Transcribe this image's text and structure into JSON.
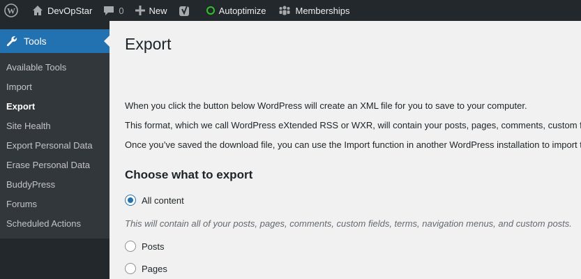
{
  "adminbar": {
    "site_name": "DevOpStar",
    "comments_count": "0",
    "new_label": "New",
    "autoptimize_label": "Autoptimize",
    "memberships_label": "Memberships",
    "autoptimize_status_color": "#2fc427"
  },
  "sidebar": {
    "menu_label": "Tools",
    "items": [
      {
        "label": "Available Tools"
      },
      {
        "label": "Import"
      },
      {
        "label": "Export",
        "current": true
      },
      {
        "label": "Site Health"
      },
      {
        "label": "Export Personal Data"
      },
      {
        "label": "Erase Personal Data"
      },
      {
        "label": "BuddyPress"
      },
      {
        "label": "Forums"
      },
      {
        "label": "Scheduled Actions"
      }
    ]
  },
  "main": {
    "title": "Export",
    "paragraphs": [
      "When you click the button below WordPress will create an XML file for you to save to your computer.",
      "This format, which we call WordPress eXtended RSS or WXR, will contain your posts, pages, comments, custom fie",
      "Once you’ve saved the download file, you can use the Import function in another WordPress installation to import t"
    ],
    "section_title": "Choose what to export",
    "options": [
      {
        "label": "All content",
        "selected": true
      },
      {
        "label": "Posts",
        "selected": false
      },
      {
        "label": "Pages",
        "selected": false
      }
    ],
    "all_content_desc": "This will contain all of your posts, pages, comments, custom fields, terms, navigation menus, and custom posts."
  }
}
